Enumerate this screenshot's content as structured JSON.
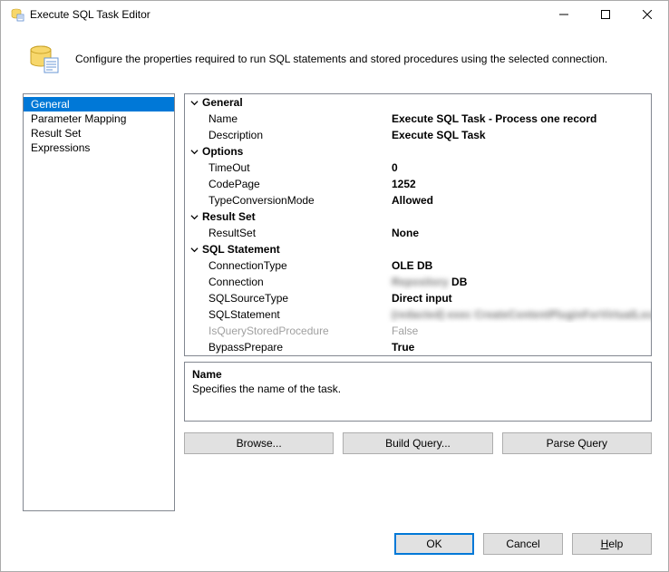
{
  "window": {
    "title": "Execute SQL Task Editor"
  },
  "header": {
    "text": "Configure the properties required to run SQL statements and stored procedures using the selected connection."
  },
  "nav": {
    "items": [
      "General",
      "Parameter Mapping",
      "Result Set",
      "Expressions"
    ],
    "selected": 0
  },
  "groups": {
    "general": {
      "title": "General",
      "name_label": "Name",
      "name_value": "Execute SQL Task - Process one record",
      "desc_label": "Description",
      "desc_value": "Execute SQL Task"
    },
    "options": {
      "title": "Options",
      "timeout_label": "TimeOut",
      "timeout_value": "0",
      "codepage_label": "CodePage",
      "codepage_value": "1252",
      "typeconv_label": "TypeConversionMode",
      "typeconv_value": "Allowed"
    },
    "resultset": {
      "title": "Result Set",
      "rs_label": "ResultSet",
      "rs_value": "None"
    },
    "sql": {
      "title": "SQL Statement",
      "conntype_label": "ConnectionType",
      "conntype_value": "OLE DB",
      "conn_label": "Connection",
      "conn_value_hidden": "Repository",
      "conn_value_suffix": " DB",
      "srctype_label": "SQLSourceType",
      "srctype_value": "Direct input",
      "stmt_label": "SQLStatement",
      "stmt_value_hidden": "(redacted) exec CreateContentPluginForVirtualLocation",
      "isqsp_label": "IsQueryStoredProcedure",
      "isqsp_value": "False",
      "bypass_label": "BypassPrepare",
      "bypass_value": "True"
    }
  },
  "description_panel": {
    "title": "Name",
    "body": "Specifies the name of the task."
  },
  "actions": {
    "browse": "Browse...",
    "build": "Build Query...",
    "parse": "Parse Query"
  },
  "footer": {
    "ok": "OK",
    "cancel": "Cancel",
    "help_prefix": "H",
    "help_rest": "elp"
  }
}
